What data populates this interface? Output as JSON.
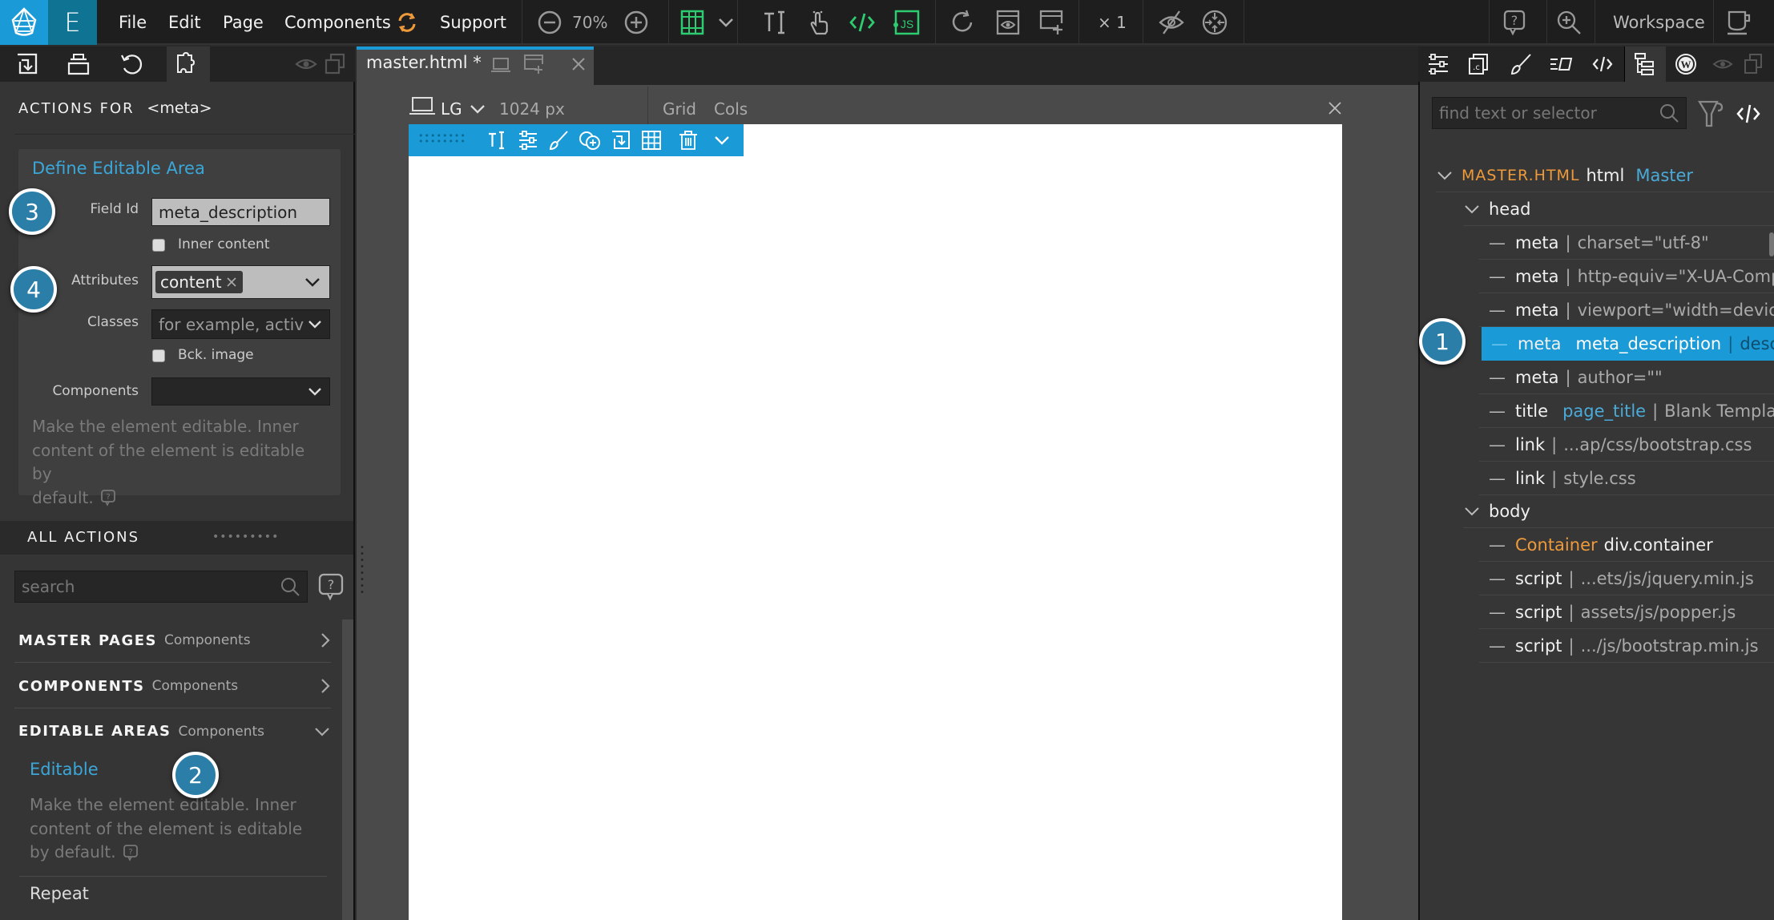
{
  "app": {
    "menu": [
      "File",
      "Edit",
      "Page",
      "Components",
      "Support"
    ],
    "zoom_level": "70%",
    "multiplier": "× 1",
    "workspace_label": "Workspace",
    "colors": {
      "accent": "#1a9ad6",
      "accent_dark": "#0f7394",
      "orange": "#ef9a3a",
      "green": "#2ecc71",
      "link_blue": "#4aaad8"
    }
  },
  "left_panel": {
    "actions_header": "ACTIONS FOR",
    "actions_target": "<meta>",
    "card": {
      "title": "Define Editable Area",
      "field_id_label": "Field Id",
      "field_id_value": "meta_description",
      "inner_content_label": "Inner content",
      "inner_content_checked": false,
      "attributes_label": "Attributes",
      "attributes_tags": [
        "content"
      ],
      "classes_label": "Classes",
      "classes_placeholder": "for example, activ",
      "bck_image_label": "Bck. image",
      "bck_image_checked": false,
      "components_label": "Components",
      "components_value": "",
      "help_lines": [
        "Make the element editable. Inner",
        "content of the element is editable by",
        "default."
      ]
    },
    "all_actions_label": "ALL ACTIONS",
    "search_placeholder": "search",
    "sections": [
      {
        "title": "MASTER PAGES",
        "sub": "Components",
        "expanded": false
      },
      {
        "title": "COMPONENTS",
        "sub": "Components",
        "expanded": false
      },
      {
        "title": "EDITABLE AREAS",
        "sub": "Components",
        "expanded": true
      }
    ],
    "editable": {
      "title": "Editable",
      "help_lines": [
        "Make the element editable. Inner",
        "content of the element is editable",
        "by default."
      ]
    },
    "repeat_label": "Repeat"
  },
  "center": {
    "tab_label": "master.html *",
    "device": "LG",
    "width_label": "1024 px",
    "grid_label": "Grid",
    "cols_label": "Cols"
  },
  "right_panel": {
    "search_placeholder": "find text or selector",
    "root": {
      "file": "MASTER.HTML",
      "tag": "html",
      "badge": "Master"
    },
    "head_label": "head",
    "body_label": "body",
    "head_rows": [
      {
        "tag": "meta",
        "attr": "charset=\"utf-8\""
      },
      {
        "tag": "meta",
        "attr": "http-equiv=\"X-UA-Compat"
      },
      {
        "tag": "meta",
        "attr": "viewport=\"width=device-w"
      },
      {
        "tag": "meta",
        "field": "meta_description",
        "attr": "desc",
        "selected": true
      },
      {
        "tag": "meta",
        "attr": "author=\"\""
      },
      {
        "tag": "title",
        "field": "page_title",
        "attr": "Blank Templat"
      },
      {
        "tag": "link",
        "attr": "...ap/css/bootstrap.css"
      },
      {
        "tag": "link",
        "attr": "style.css"
      }
    ],
    "body_rows": [
      {
        "component": "Container",
        "tag": "div.container"
      },
      {
        "tag": "script",
        "attr": "...ets/js/jquery.min.js"
      },
      {
        "tag": "script",
        "attr": "assets/js/popper.js"
      },
      {
        "tag": "script",
        "attr": ".../js/bootstrap.min.js"
      }
    ]
  },
  "badges": [
    "1",
    "2",
    "3",
    "4"
  ]
}
